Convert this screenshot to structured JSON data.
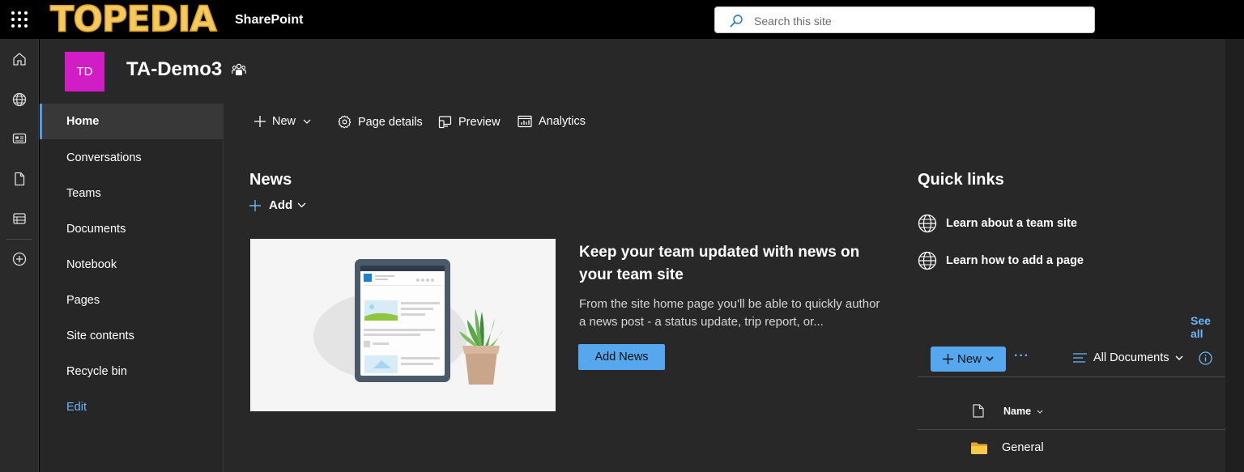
{
  "topbar": {
    "logo_text": "TOPEDIA",
    "app_name": "SharePoint",
    "search_placeholder": "Search this site"
  },
  "site": {
    "logo_initials": "TD",
    "title": "TA-Demo3"
  },
  "rail": [
    "home-icon",
    "globe-icon",
    "news-icon",
    "document-icon",
    "list-icon",
    "add-circle-icon"
  ],
  "leftnav": {
    "items": [
      {
        "label": "Home",
        "active": true
      },
      {
        "label": "Conversations"
      },
      {
        "label": "Teams"
      },
      {
        "label": "Documents"
      },
      {
        "label": "Notebook"
      },
      {
        "label": "Pages"
      },
      {
        "label": "Site contents"
      },
      {
        "label": "Recycle bin"
      }
    ],
    "edit_label": "Edit"
  },
  "commandbar": {
    "new_label": "New",
    "page_details_label": "Page details",
    "preview_label": "Preview",
    "analytics_label": "Analytics"
  },
  "news": {
    "title": "News",
    "add_label": "Add",
    "headline": "Keep your team updated with news on your team site",
    "description": "From the site home page you'll be able to quickly author a news post - a status update, trip report, or...",
    "add_news_button": "Add News"
  },
  "quicklinks": {
    "title": "Quick links",
    "items": [
      {
        "label": "Learn about a team site"
      },
      {
        "label": "Learn how to add a page"
      }
    ]
  },
  "documents": {
    "see_all": "See all",
    "new_label": "New",
    "more_label": "···",
    "view_label": "All Documents",
    "column_name": "Name",
    "rows": [
      {
        "name": "General"
      }
    ]
  },
  "colors": {
    "accent": "#56a7ee",
    "link": "#6cb4f7",
    "site_logo": "#d21cc6",
    "folder": "#f7c948"
  }
}
